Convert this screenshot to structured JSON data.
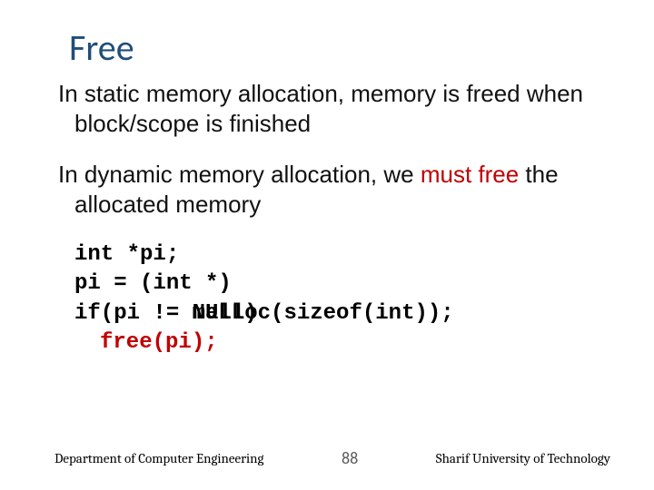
{
  "title": "Free",
  "bullets": {
    "b0": "In static memory allocation, memory is freed when block/scope is finished",
    "b1_pre": "In dynamic memory allocation, we ",
    "b1_red": "must free",
    "b1_post": " the allocated memory"
  },
  "code": {
    "l0": "int *pi;",
    "l1": "pi = (int *)",
    "l2_pre": "if(pi != ",
    "l2_under": "NULL)",
    "l2_over": "malloc(sizeof(int));",
    "l3": "free(pi);"
  },
  "footer": {
    "left": "Department of Computer Engineering",
    "page": "88",
    "right": "Sharif University of Technology"
  }
}
